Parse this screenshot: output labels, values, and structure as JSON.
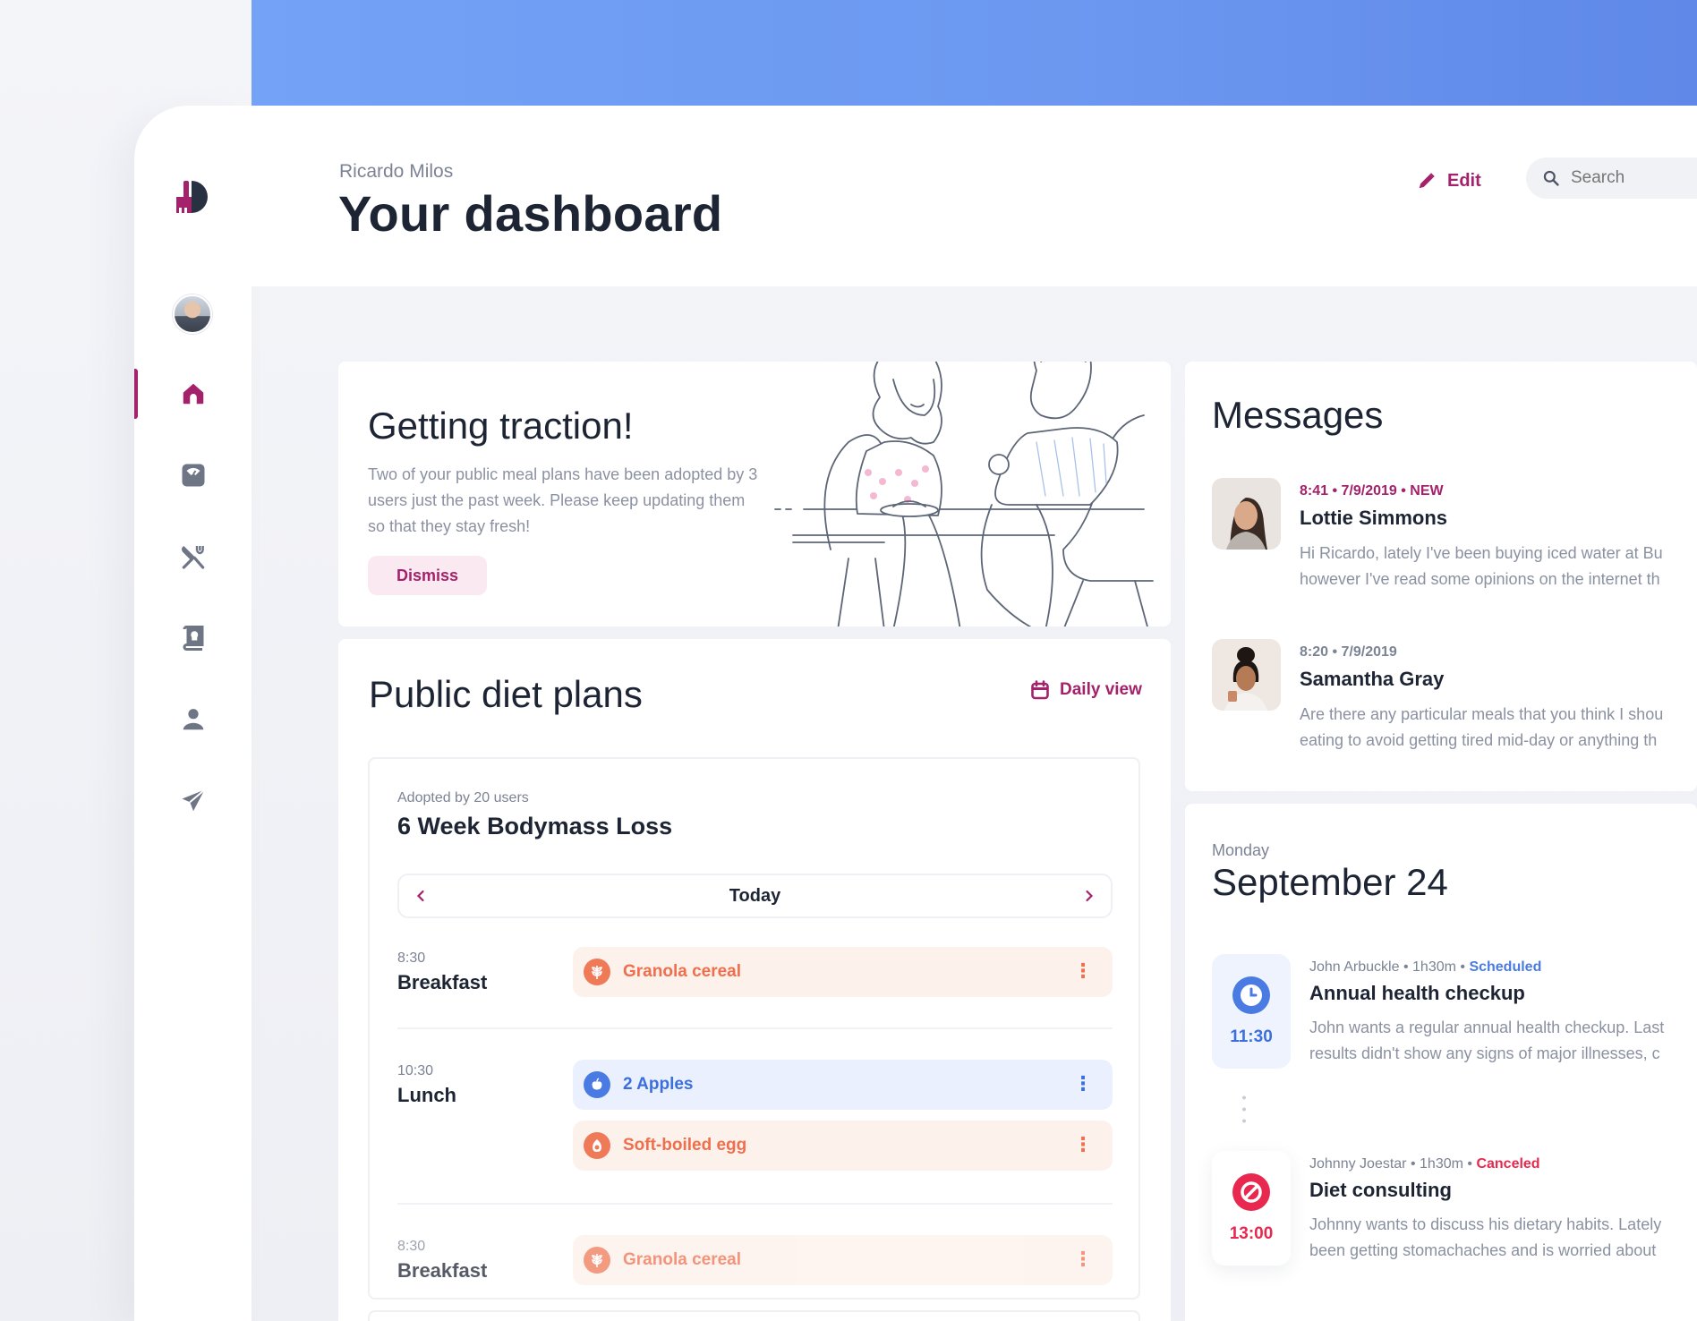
{
  "header": {
    "user_name": "Ricardo Milos",
    "title": "Your dashboard",
    "edit_label": "Edit",
    "search_placeholder": "Search"
  },
  "sidebar": {
    "items": [
      {
        "icon": "home-icon",
        "active": true
      },
      {
        "icon": "scale-icon",
        "active": false
      },
      {
        "icon": "utensils-icon",
        "active": false
      },
      {
        "icon": "recipe-book-icon",
        "active": false
      },
      {
        "icon": "person-icon",
        "active": false
      },
      {
        "icon": "send-icon",
        "active": false
      }
    ]
  },
  "traction": {
    "title": "Getting traction!",
    "body": "Two of your public meal plans have been adopted by 3 users just the past week. Please keep updating them so that they stay fresh!",
    "dismiss_label": "Dismiss"
  },
  "plans": {
    "title": "Public diet plans",
    "daily_view_label": "Daily view",
    "plan": {
      "adopted": "Adopted by 20 users",
      "name": "6 Week Bodymass Loss",
      "day_label": "Today",
      "meals": [
        {
          "time": "8:30",
          "name": "Breakfast",
          "items": [
            {
              "label": "Granola cereal",
              "color": "orange",
              "icon": "wheat-icon"
            }
          ]
        },
        {
          "time": "10:30",
          "name": "Lunch",
          "items": [
            {
              "label": "2 Apples",
              "color": "blue",
              "icon": "apple-icon"
            },
            {
              "label": "Soft-boiled egg",
              "color": "orange",
              "icon": "egg-icon"
            }
          ]
        },
        {
          "time": "8:30",
          "name": "Breakfast",
          "items": [
            {
              "label": "Granola cereal",
              "color": "orange",
              "icon": "wheat-icon"
            }
          ]
        }
      ]
    }
  },
  "messages": {
    "title": "Messages",
    "items": [
      {
        "meta": "8:41  •  7/9/2019  •  NEW",
        "from": "Lottie Simmons",
        "line1": "Hi Ricardo, lately I've been buying iced water at Bu",
        "line2": "however I've read some opinions on the internet th"
      },
      {
        "meta": "8:20  •  7/9/2019",
        "from": "Samantha Gray",
        "line1": "Are there any particular meals that you think I shou",
        "line2": "eating to avoid getting tired mid-day or anything th"
      }
    ]
  },
  "schedule": {
    "day": "Monday",
    "date": "September 24",
    "appointments": [
      {
        "time": "11:30",
        "person": "John Arbuckle",
        "duration": "1h30m",
        "status": "Scheduled",
        "title": "Annual health checkup",
        "line1": "John wants a regular annual health checkup. Last",
        "line2": "results didn't show any signs of major illnesses, c"
      },
      {
        "time": "13:00",
        "person": "Johnny Joestar",
        "duration": "1h30m",
        "status": "Canceled",
        "title": "Diet consulting",
        "line1": "Johnny wants to discuss his dietary habits. Lately",
        "line2": "been getting stomachaches and is worried about"
      }
    ]
  },
  "colors": {
    "brand": "#a3226b",
    "header_band": "#6b97f0",
    "scheduled": "#4a7be3",
    "canceled": "#e8284f",
    "orange": "#ef6f4d"
  }
}
